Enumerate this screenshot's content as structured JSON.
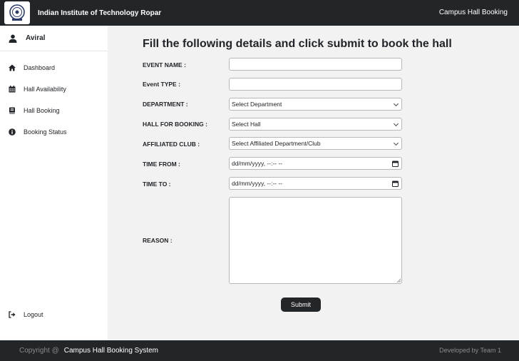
{
  "header": {
    "institute": "Indian Institute of Technology Ropar",
    "app_name": "Campus Hall Booking"
  },
  "sidebar": {
    "user": "Aviral",
    "items": [
      {
        "label": "Dashboard",
        "icon": "home-icon"
      },
      {
        "label": "Hall Availability",
        "icon": "calendar-icon"
      },
      {
        "label": "Hall Booking",
        "icon": "book-icon"
      },
      {
        "label": "Booking Status",
        "icon": "info-icon"
      }
    ],
    "logout": "Logout"
  },
  "form": {
    "heading": "Fill the following details and click submit to book the hall",
    "event_name_label": "EVENT NAME :",
    "event_name_value": "",
    "event_type_label": "Event TYPE :",
    "event_type_value": "",
    "department_label": "DEPARTMENT :",
    "department_value": "Select Department",
    "hall_label": "HALL FOR BOOKING :",
    "hall_value": "Select Hall",
    "club_label": "AFFILIATED CLUB :",
    "club_value": "Select Affiliated Department/Club",
    "time_from_label": "TIME FROM :",
    "time_from_value": "dd/mm/yyyy, --:-- --",
    "time_to_label": "TIME TO :",
    "time_to_value": "dd/mm/yyyy, --:-- --",
    "reason_label": "REASON :",
    "reason_value": "",
    "submit": "Submit"
  },
  "footer": {
    "copyright": "Copyright @",
    "system_name": "Campus Hall Booking System",
    "developer": "Developed by Team 1"
  },
  "colors": {
    "dark_bar": "#222629",
    "page_bg": "#f2f2f2",
    "sidebar_bg": "#ffffff"
  }
}
